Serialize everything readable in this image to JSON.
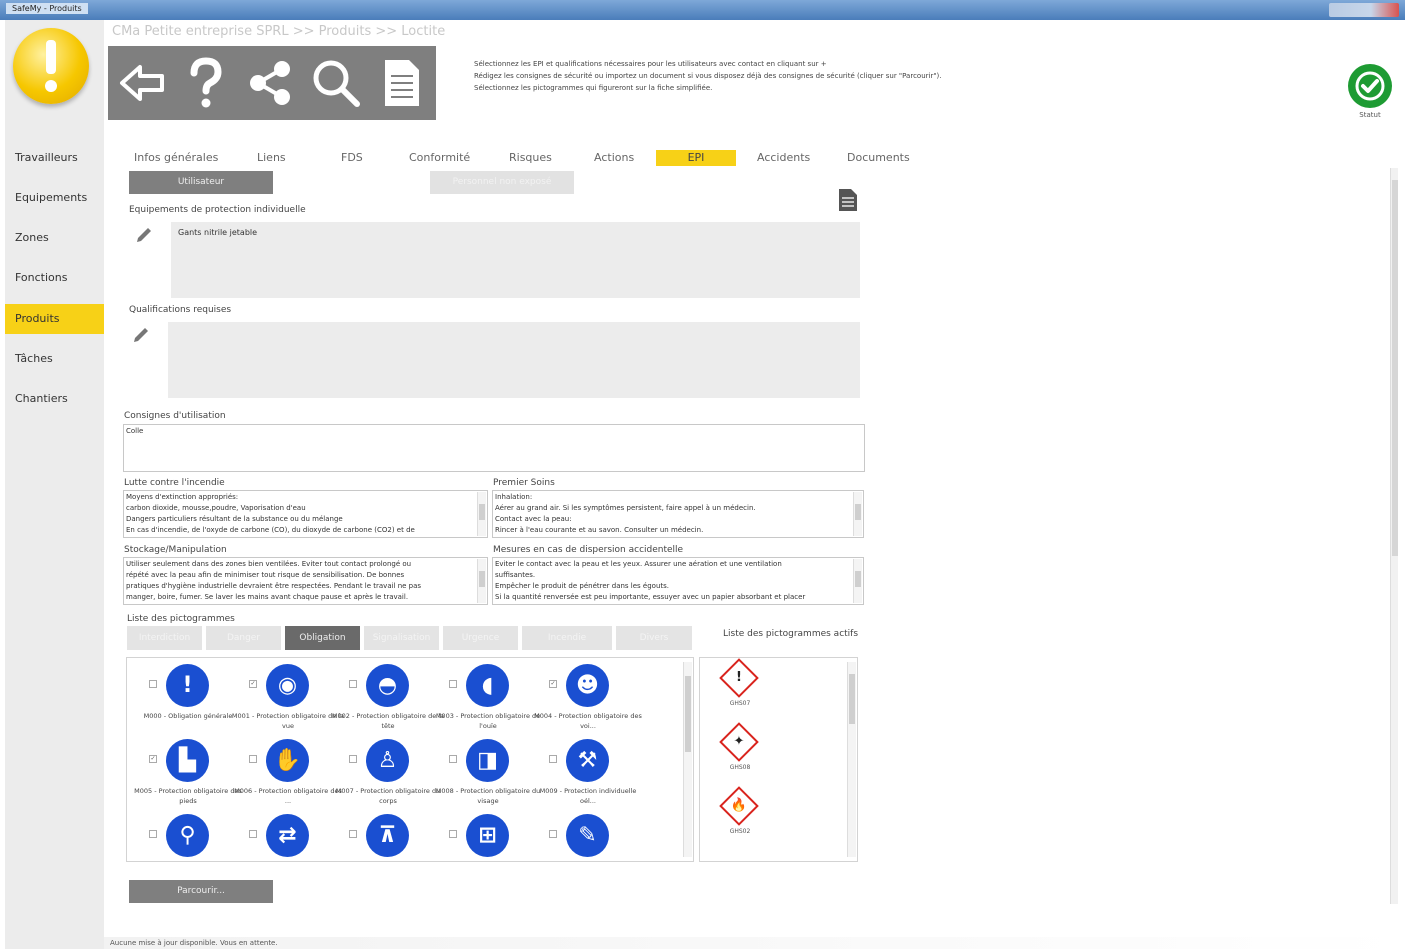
{
  "window": {
    "title": "SafeMy - Produits"
  },
  "breadcrumb": "CMa Petite entreprise SPRL >> Produits >> Loctite",
  "toolbar": {
    "icons": [
      "back-arrow-icon",
      "help-icon",
      "share-icon",
      "search-icon",
      "document-icon"
    ]
  },
  "instructions": {
    "line1": "Sélectionnez les EPI et qualifications nécessaires pour les utilisateurs avec contact en cliquant sur +",
    "line2": "Rédigez les consignes de sécurité ou importez un document si vous disposez déjà des consignes de sécurité (cliquer sur \"Parcourir\").",
    "line3": "Sélectionnez les pictogrammes qui figureront sur la fiche simplifiée."
  },
  "status": {
    "label": "Statut",
    "color": "#1e9b33"
  },
  "sidebar": {
    "items": [
      {
        "label": "Travailleurs"
      },
      {
        "label": "Equipements"
      },
      {
        "label": "Zones"
      },
      {
        "label": "Fonctions"
      },
      {
        "label": "Produits",
        "active": true
      },
      {
        "label": "Tâches"
      },
      {
        "label": "Chantiers"
      }
    ],
    "active_color": "#f7d117"
  },
  "tabs": [
    {
      "label": "Infos générales"
    },
    {
      "label": "Liens"
    },
    {
      "label": "FDS"
    },
    {
      "label": "Conformité"
    },
    {
      "label": "Risques"
    },
    {
      "label": "Actions"
    },
    {
      "label": "EPI",
      "active": true
    },
    {
      "label": "Accidents"
    },
    {
      "label": "Documents"
    }
  ],
  "subtabs": {
    "user": "Utilisateur",
    "other": "Personnel non exposé"
  },
  "epi": {
    "label": "Equipements de protection individuelle",
    "value": "Gants nitrile jetable"
  },
  "qualifications": {
    "label": "Qualifications requises",
    "value": ""
  },
  "consignes": {
    "label": "Consignes d'utilisation",
    "value": "Colle"
  },
  "incendie": {
    "label": "Lutte contre l'incendie",
    "lines": [
      "Moyens d'extinction appropriés:",
      "carbon dioxide, mousse,poudre, Vaporisation d'eau",
      "Dangers particuliers résultant de la substance ou du mélange",
      "En cas d'incendie, de l'oxyde de carbone (CO), du dioxyde de carbone (CO2) et de"
    ]
  },
  "premiers_soins": {
    "label": "Premier Soins",
    "lines": [
      "Inhalation:",
      "Aérer au grand air. Si les symptômes persistent, faire appel à un médecin.",
      "Contact avec la peau:",
      "Rincer à l'eau courante et au savon. Consulter un médecin."
    ]
  },
  "stockage": {
    "label": "Stockage/Manipulation",
    "lines": [
      "Utiliser seulement dans des zones bien ventilées. Eviter tout contact prolongé ou",
      "répété avec la peau afin de minimiser tout risque de sensibilisation. De bonnes",
      "pratiques d'hygiène industrielle devraient être respectées. Pendant le travail ne pas",
      "manger, boire, fumer. Se laver les mains avant chaque pause et après le travail."
    ]
  },
  "dispersion": {
    "label": "Mesures en cas de dispersion accidentelle",
    "lines": [
      "Eviter le contact avec la peau et les yeux. Assurer une aération et une ventilation",
      "suffisantes.",
      "Empêcher le produit de pénétrer dans les égouts.",
      "Si la quantité renversée est peu importante, essuyer avec un papier absorbant et placer"
    ]
  },
  "pictos": {
    "label": "Liste des pictogrammes",
    "tabs": [
      "Interdiction",
      "Danger",
      "Obligation",
      "Signalisation",
      "Urgence",
      "Incendie",
      "Divers"
    ],
    "active_tab": "Obligation",
    "active_list_label": "Liste des pictogrammes actifs",
    "items": [
      {
        "name": "M000 - Obligation générale",
        "icon": "exclamation-icon",
        "checked": false
      },
      {
        "name": "M001 - Protection obligatoire de la vue",
        "icon": "goggles-icon",
        "checked": true
      },
      {
        "name": "M002 - Protection obligatoire de la tête",
        "icon": "helmet-icon",
        "checked": false
      },
      {
        "name": "M003 - Protection obligatoire de l'ouïe",
        "icon": "ear-protection-icon",
        "checked": false
      },
      {
        "name": "M004 - Protection obligatoire des voi...",
        "icon": "mask-icon",
        "checked": true
      },
      {
        "name": "M005 - Protection obligatoire des pieds",
        "icon": "boot-icon",
        "checked": true
      },
      {
        "name": "M006 - Protection obligatoire des ...",
        "icon": "glove-icon",
        "checked": false
      },
      {
        "name": "M007 - Protection obligatoire du corps",
        "icon": "overall-icon",
        "checked": false
      },
      {
        "name": "M008 - Protection obligatoire du visage",
        "icon": "face-shield-icon",
        "checked": false
      },
      {
        "name": "M009 - Protection individuelle oél...",
        "icon": "harness-icon",
        "checked": false
      },
      {
        "name": "",
        "icon": "pedestrian-icon",
        "checked": false
      },
      {
        "name": "",
        "icon": "connect-icon",
        "checked": false
      },
      {
        "name": "",
        "icon": "ladder-icon",
        "checked": false
      },
      {
        "name": "",
        "icon": "plug-icon",
        "checked": false
      },
      {
        "name": "",
        "icon": "tool-icon",
        "checked": false
      }
    ],
    "active": [
      {
        "code": "GHS07",
        "symbol": "!"
      },
      {
        "code": "GHS08",
        "symbol": "✦"
      },
      {
        "code": "GHS02",
        "symbol": "🔥"
      }
    ]
  },
  "browse_button": "Parcourir...",
  "statusbar": "Aucune mise à jour disponible. Vous en attente."
}
